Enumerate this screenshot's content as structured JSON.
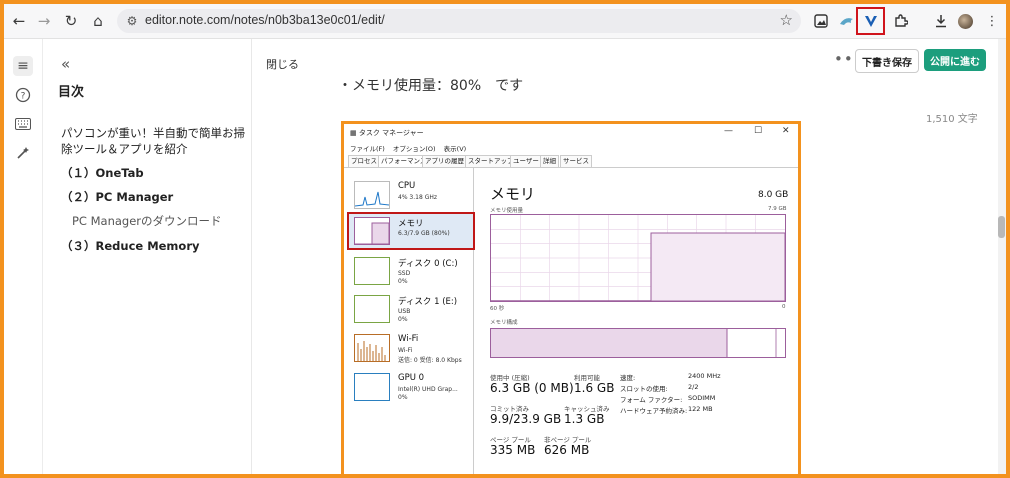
{
  "browser": {
    "url": "editor.note.com/notes/n0b3ba13e0c01/edit/",
    "nav_icons": [
      "back-arrow-icon",
      "forward-arrow-icon",
      "reload-icon",
      "home-icon"
    ]
  },
  "toc": {
    "title": "目次",
    "items": [
      {
        "text": "パソコンが重い！半自動で簡単お掃除ツール＆アプリを紹介"
      },
      {
        "text": "（１）OneTab"
      },
      {
        "text": "（２）PC Manager"
      },
      {
        "text": "PC Managerのダウンロード"
      },
      {
        "text": "（３）Reduce Memory"
      }
    ]
  },
  "editor": {
    "close_label": "閉じる",
    "more_label": "•••",
    "draft_label": "下書き保存",
    "publish_label": "公開に進む",
    "body_line": "・メモリ使用量：80%　です",
    "char_count": "1,510 文字"
  },
  "taskmanager": {
    "window_title": "タスク マネージャー",
    "menu": [
      "ファイル(F)",
      "オプション(O)",
      "表示(V)"
    ],
    "tabs": [
      "プロセス",
      "パフォーマンス",
      "アプリの履歴",
      "スタートアップ",
      "ユーザー",
      "詳細",
      "サービス"
    ],
    "resources": [
      {
        "name": "CPU",
        "l1": "4%  3.18 GHz",
        "l2": ""
      },
      {
        "name": "メモリ",
        "l1": "6.3/7.9 GB (80%)",
        "l2": ""
      },
      {
        "name": "ディスク 0 (C:)",
        "l1": "SSD",
        "l2": "0%"
      },
      {
        "name": "ディスク 1 (E:)",
        "l1": "USB",
        "l2": "0%"
      },
      {
        "name": "Wi-Fi",
        "l1": "Wi-Fi",
        "l2": "送信: 0 受信: 8.0 Kbps"
      },
      {
        "name": "GPU 0",
        "l1": "Intel(R) UHD Grap...",
        "l2": "0%"
      }
    ],
    "memory": {
      "title": "メモリ",
      "total": "8.0 GB",
      "usage_label": "メモリ使用量",
      "usage_max": "7.9 GB",
      "axis_left": "60 秒",
      "axis_right": "0",
      "composition_label": "メモリ構成",
      "stats": {
        "in_use_label": "使用中 (圧縮)",
        "in_use": "6.3 GB (0 MB)",
        "available_label": "利用可能",
        "available": "1.6 GB",
        "committed_label": "コミット済み",
        "committed": "9.9/23.9 GB",
        "cached_label": "キャッシュ済み",
        "cached": "1.3 GB",
        "paged_label": "ページ プール",
        "paged": "335 MB",
        "nonpaged_label": "非ページ プール",
        "nonpaged": "626 MB",
        "speed_label": "速度:",
        "speed": "2400 MHz",
        "slots_label": "スロットの使用:",
        "slots": "2/2",
        "form_label": "フォーム ファクター:",
        "form": "SODIMM",
        "hw_label": "ハードウェア予約済み:",
        "hw": "122 MB"
      }
    }
  }
}
